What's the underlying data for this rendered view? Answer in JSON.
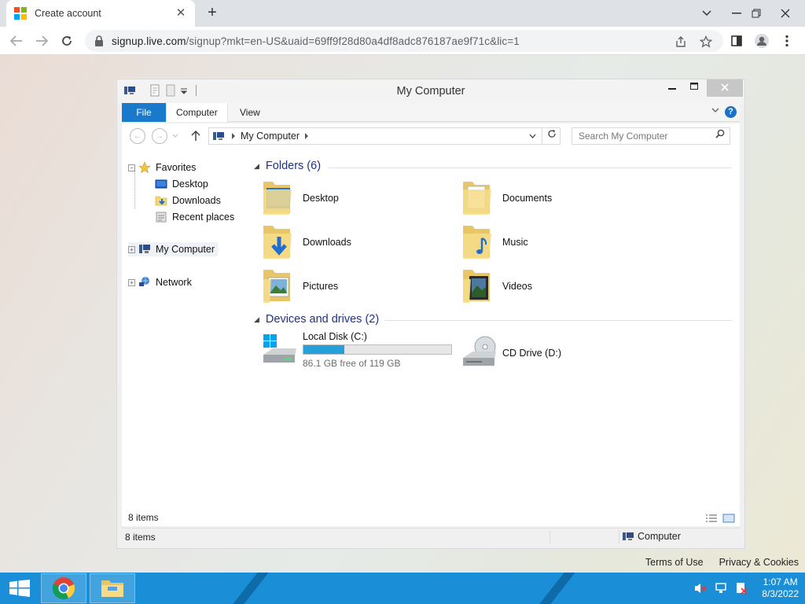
{
  "browser": {
    "tab_title": "Create account",
    "tab_close": "✕",
    "new_tab": "+",
    "url_host": "signup.live.com",
    "url_rest": "/signup?mkt=en-US&uaid=69ff9f28d80a4df8adc876187ae9f71c&lic=1"
  },
  "page": {
    "footer_links": [
      "Terms of Use",
      "Privacy & Cookies"
    ]
  },
  "explorer": {
    "title": "My Computer",
    "ribbon_tabs": [
      "File",
      "Computer",
      "View"
    ],
    "help_label": "?",
    "address_segment": "My Computer",
    "search_placeholder": "Search My Computer",
    "nav": {
      "favorites": "Favorites",
      "desktop": "Desktop",
      "downloads": "Downloads",
      "recent": "Recent places",
      "my_computer": "My Computer",
      "network": "Network"
    },
    "folders_header": "Folders (6)",
    "folders": [
      "Desktop",
      "Documents",
      "Downloads",
      "Music",
      "Pictures",
      "Videos"
    ],
    "devices_header": "Devices and drives (2)",
    "drive_c": {
      "name": "Local Disk (C:)",
      "free_text": "86.1 GB free of 119 GB",
      "used_fraction": 0.276
    },
    "drive_d": {
      "name": "CD Drive (D:)"
    },
    "item_count": "8 items",
    "status_count": "8 items",
    "status_location": "Computer"
  },
  "taskbar": {
    "time": "1:07 AM",
    "date": "8/3/2022"
  },
  "colors": {
    "accent": "#1979ca",
    "taskbar": "#1a8fd8",
    "progress": "#26a0da",
    "section_header": "#1e3287"
  }
}
